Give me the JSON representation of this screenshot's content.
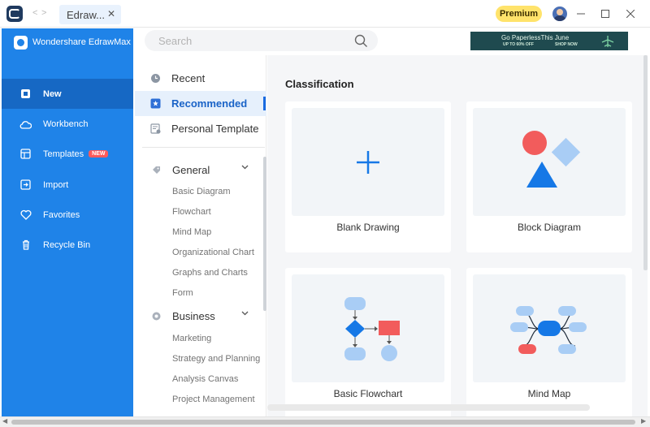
{
  "titlebar": {
    "tab_title": "Edraw...",
    "premium_label": "Premium"
  },
  "sidebar": {
    "brand": "Wondershare EdrawMax",
    "items": [
      {
        "label": "New",
        "icon": "new-file-icon",
        "active": true
      },
      {
        "label": "Workbench",
        "icon": "cloud-icon"
      },
      {
        "label": "Templates",
        "icon": "templates-icon",
        "badge": "NEW"
      },
      {
        "label": "Import",
        "icon": "import-icon"
      },
      {
        "label": "Favorites",
        "icon": "heart-icon"
      },
      {
        "label": "Recycle Bin",
        "icon": "trash-icon"
      }
    ]
  },
  "search": {
    "placeholder": "Search"
  },
  "banner": {
    "line1": "Go PaperlessThis June",
    "line2": "UP TO 60% OFF",
    "cta": "SHOP NOW"
  },
  "categories": {
    "top": [
      {
        "label": "Recent",
        "icon": "clock-icon"
      },
      {
        "label": "Recommended",
        "icon": "star-icon",
        "active": true
      },
      {
        "label": "Personal Template",
        "icon": "personal-template-icon"
      }
    ],
    "groups": [
      {
        "label": "General",
        "items": [
          "Basic Diagram",
          "Flowchart",
          "Mind Map",
          "Organizational Chart",
          "Graphs and Charts",
          "Form"
        ]
      },
      {
        "label": "Business",
        "items": [
          "Marketing",
          "Strategy and Planning",
          "Analysis Canvas",
          "Project Management"
        ]
      }
    ]
  },
  "content": {
    "section_title": "Classification",
    "cards": [
      {
        "label": "Blank Drawing"
      },
      {
        "label": "Block Diagram"
      },
      {
        "label": "Basic Flowchart"
      },
      {
        "label": "Mind Map"
      }
    ]
  },
  "colors": {
    "sidebar_bg": "#1f83e8",
    "sidebar_active": "#1668c4",
    "accent": "#1a6be0",
    "premium": "#ffe36b",
    "shape_red": "#f25c5c",
    "shape_blue": "#1678e6",
    "shape_light_blue": "#a9cdf5"
  }
}
